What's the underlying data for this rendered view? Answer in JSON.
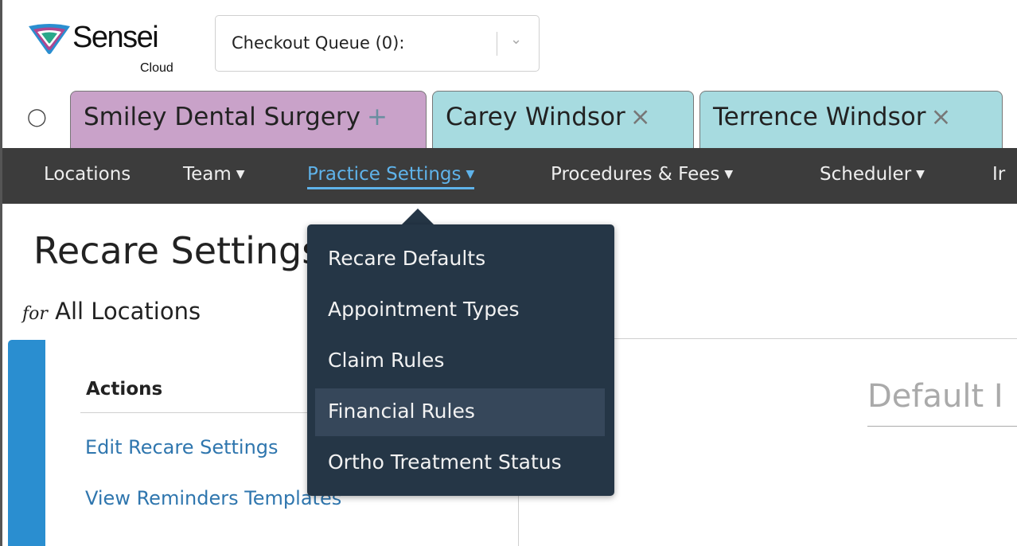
{
  "brand": {
    "name": "Sensei",
    "sub": "Cloud",
    "mark_color": "#2a8ed0"
  },
  "checkout": {
    "label": "Checkout Queue (0):",
    "caret_icon": "chevron-down-icon"
  },
  "tabs": [
    {
      "label": "Smiley Dental Surgery",
      "symbol": "+",
      "color": "#c9a2c9"
    },
    {
      "label": "Carey Windsor",
      "symbol": "×",
      "color": "#a7dbe0"
    },
    {
      "label": "Terrence Windsor",
      "symbol": "×",
      "color": "#a7dbe0"
    }
  ],
  "nav": {
    "items": [
      {
        "label": "Locations"
      },
      {
        "label": "Team"
      },
      {
        "label": "Practice Settings"
      },
      {
        "label": "Procedures & Fees"
      },
      {
        "label": "Scheduler"
      },
      {
        "label": "Ir"
      }
    ],
    "active_color": "#5fb3ea",
    "bg_color": "#3c3c3c"
  },
  "page": {
    "title": "Recare Settings",
    "sub_prefix": "for",
    "sub_text": "All Locations"
  },
  "actions": {
    "heading": "Actions",
    "links": [
      "Edit Recare Settings",
      "View Reminders Templates"
    ],
    "link_color": "#2f76ae"
  },
  "main": {
    "heading": "Default I"
  },
  "dropdown": {
    "items": [
      "Recare Defaults",
      "Appointment Types",
      "Claim Rules",
      "Financial Rules",
      "Ortho Treatment Status"
    ],
    "highlighted": "Financial Rules",
    "bg_color": "#253646"
  }
}
